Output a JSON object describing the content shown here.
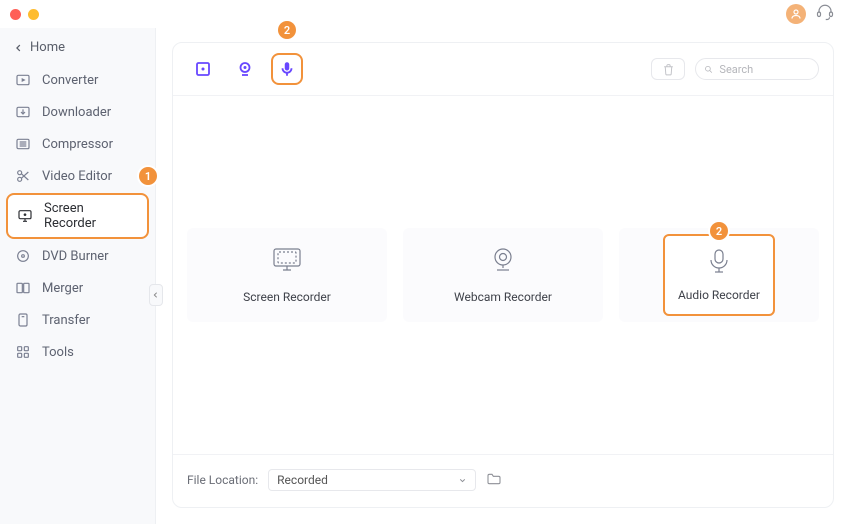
{
  "colors": {
    "accent_orange": "#f2923b",
    "accent_purple": "#6847ff"
  },
  "titlebar": {},
  "sidebar": {
    "home_label": "Home",
    "items": [
      {
        "label": "Converter"
      },
      {
        "label": "Downloader"
      },
      {
        "label": "Compressor"
      },
      {
        "label": "Video Editor"
      },
      {
        "label": "Screen Recorder"
      },
      {
        "label": "DVD Burner"
      },
      {
        "label": "Merger"
      },
      {
        "label": "Transfer"
      },
      {
        "label": "Tools"
      }
    ]
  },
  "badges": {
    "sidebar_video_editor": "1",
    "toolbar_audio": "2",
    "card_audio": "2"
  },
  "toolbar": {
    "search_placeholder": "Search"
  },
  "cards": [
    {
      "label": "Screen Recorder"
    },
    {
      "label": "Webcam Recorder"
    },
    {
      "label": "Audio Recorder"
    }
  ],
  "footer": {
    "label": "File Location:",
    "value": "Recorded"
  }
}
